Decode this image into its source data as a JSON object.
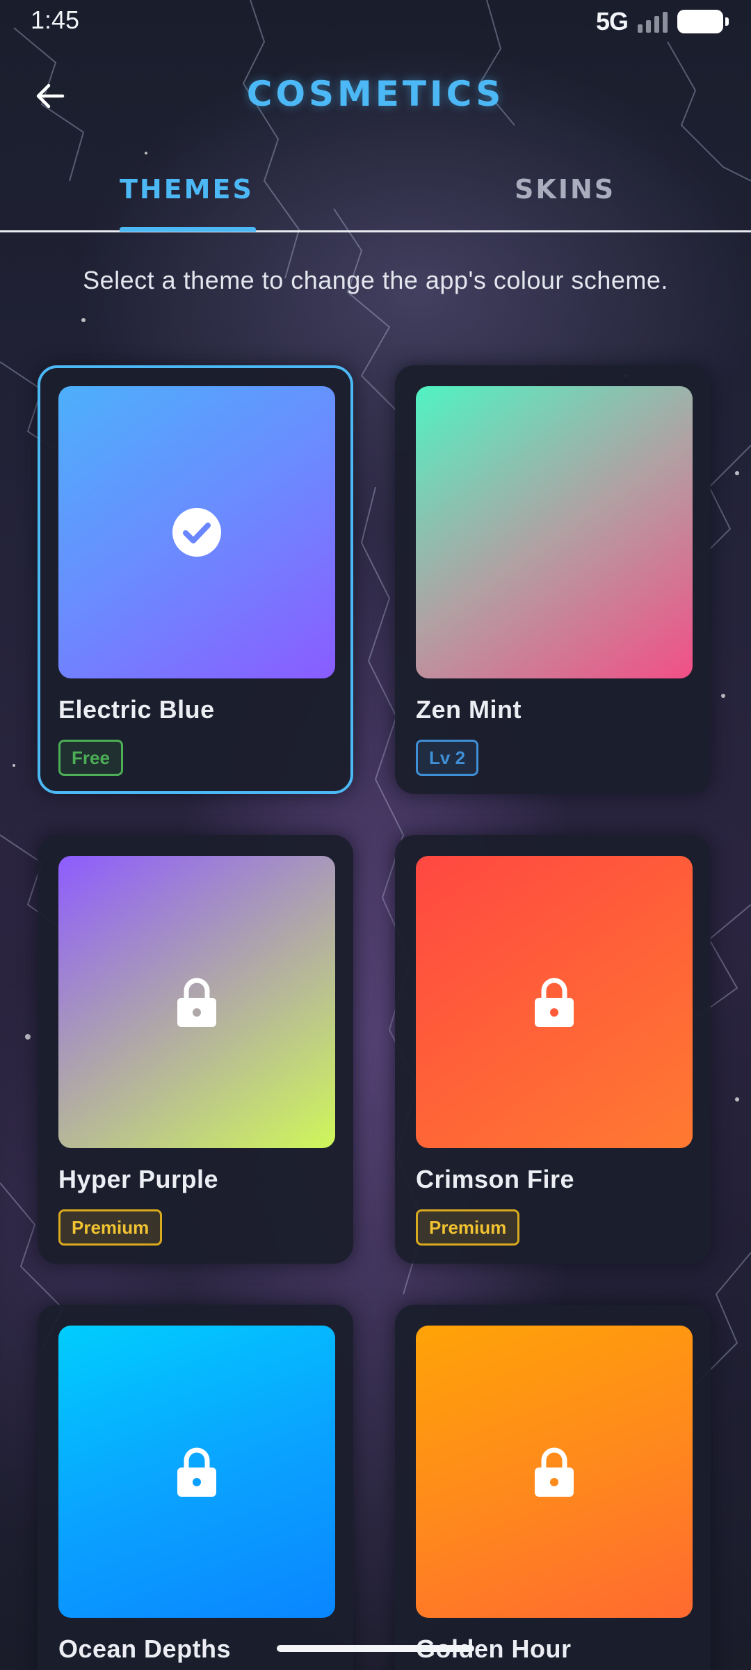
{
  "status_bar": {
    "time": "1:45",
    "network": "5G"
  },
  "header": {
    "title": "COSMETICS",
    "back_icon": "arrow-left-icon"
  },
  "tabs": [
    {
      "label": "THEMES",
      "active": true
    },
    {
      "label": "SKINS",
      "active": false
    }
  ],
  "subtitle": "Select a theme to change the app's colour scheme.",
  "themes": [
    {
      "name": "Electric Blue",
      "badge": "Free",
      "badge_type": "free",
      "selected": true,
      "locked": false,
      "icon": "check-circle-icon",
      "gradient": [
        "#4db0fb",
        "#8a5cff"
      ]
    },
    {
      "name": "Zen Mint",
      "badge": "Lv 2",
      "badge_type": "level",
      "selected": false,
      "locked": false,
      "gradient": [
        "#50f3c2",
        "#f24f86"
      ]
    },
    {
      "name": "Hyper Purple",
      "badge": "Premium",
      "badge_type": "premium",
      "selected": false,
      "locked": true,
      "icon": "lock-icon",
      "gradient": [
        "#8d5cff",
        "#cff75a"
      ]
    },
    {
      "name": "Crimson Fire",
      "badge": "Premium",
      "badge_type": "premium",
      "selected": false,
      "locked": true,
      "icon": "lock-icon",
      "gradient": [
        "#ff4842",
        "#ff7a32"
      ]
    },
    {
      "name": "Ocean Depths",
      "badge": "",
      "badge_type": "",
      "selected": false,
      "locked": true,
      "icon": "lock-icon",
      "gradient": [
        "#00cdfd",
        "#0a86ff"
      ]
    },
    {
      "name": "Golden Hour",
      "badge": "",
      "badge_type": "",
      "selected": false,
      "locked": true,
      "icon": "lock-icon",
      "gradient": [
        "#ffa307",
        "#ff6a30"
      ]
    }
  ],
  "colors": {
    "accent": "#4cb8f5",
    "card_bg": "#1b1e2c",
    "free": "#4cae55",
    "level": "#3f8fd6",
    "premium": "#f1c232"
  }
}
